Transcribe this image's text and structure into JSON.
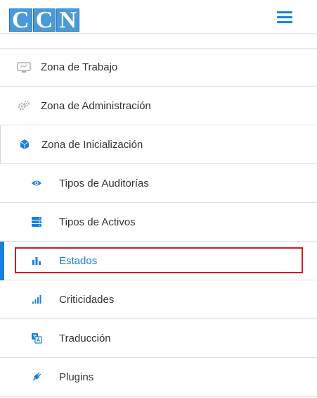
{
  "header": {
    "logo_letters": [
      "C",
      "C",
      "N"
    ]
  },
  "menu": {
    "items": [
      {
        "label": "Zona de Trabajo"
      },
      {
        "label": "Zona de Administración"
      },
      {
        "label": "Zona de Inicialización"
      }
    ],
    "subitems": [
      {
        "label": "Tipos de Auditorías"
      },
      {
        "label": "Tipos de Activos"
      },
      {
        "label": "Estados"
      },
      {
        "label": "Criticidades"
      },
      {
        "label": "Traducción"
      },
      {
        "label": "Plugins"
      }
    ]
  },
  "colors": {
    "accent": "#1a7fdc",
    "highlight": "#c81e24"
  }
}
